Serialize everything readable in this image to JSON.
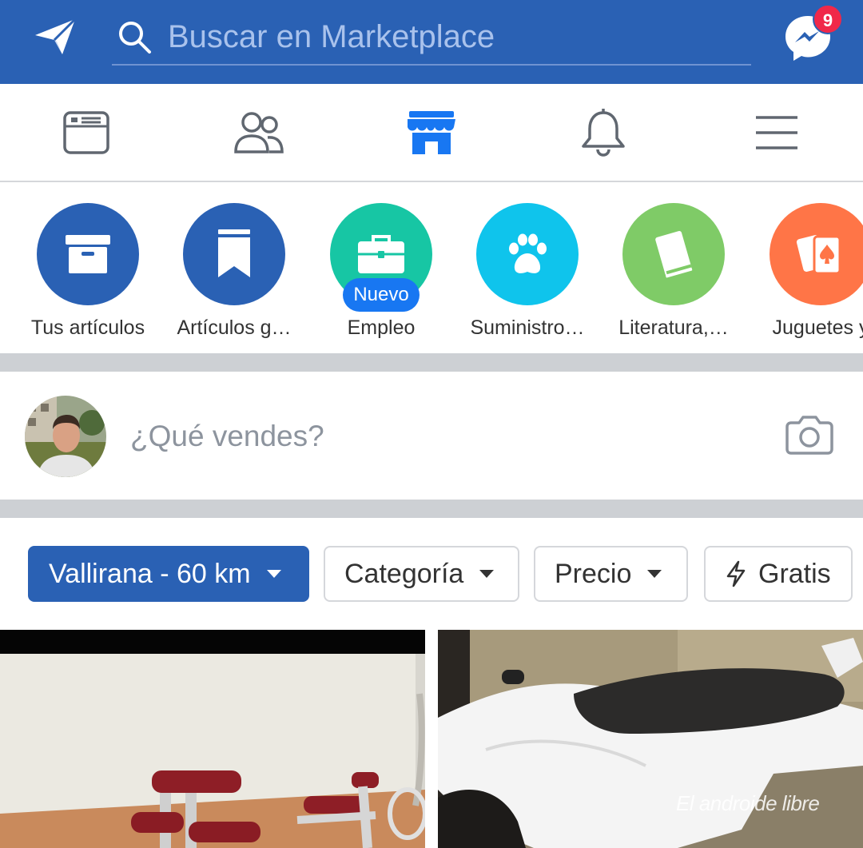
{
  "header": {
    "search_placeholder": "Buscar en Marketplace",
    "messenger_badge": "9",
    "brand_color": "#2a61b4"
  },
  "nav": {
    "items": [
      {
        "icon": "news-feed-icon"
      },
      {
        "icon": "friends-icon"
      },
      {
        "icon": "marketplace-icon",
        "active": true
      },
      {
        "icon": "notifications-icon"
      },
      {
        "icon": "menu-icon"
      }
    ]
  },
  "categories": [
    {
      "label": "Tus artículos",
      "icon": "archive-box-icon",
      "color": "#2a61b4"
    },
    {
      "label": "Artículos g…",
      "icon": "bookmark-icon",
      "color": "#2a61b4"
    },
    {
      "label": "Empleo",
      "icon": "briefcase-icon",
      "color": "#17c6a4",
      "badge": "Nuevo"
    },
    {
      "label": "Suministro…",
      "icon": "paw-icon",
      "color": "#0fc4ec"
    },
    {
      "label": "Literatura,…",
      "icon": "book-icon",
      "color": "#7fcb67"
    },
    {
      "label": "Juguetes y",
      "icon": "cards-icon",
      "color": "#ff7547"
    }
  ],
  "composer": {
    "placeholder": "¿Qué vendes?"
  },
  "filters": {
    "location": "Vallirana - 60 km",
    "category": "Categoría",
    "price": "Precio",
    "free": "Gratis"
  },
  "watermark": "El androide libre"
}
